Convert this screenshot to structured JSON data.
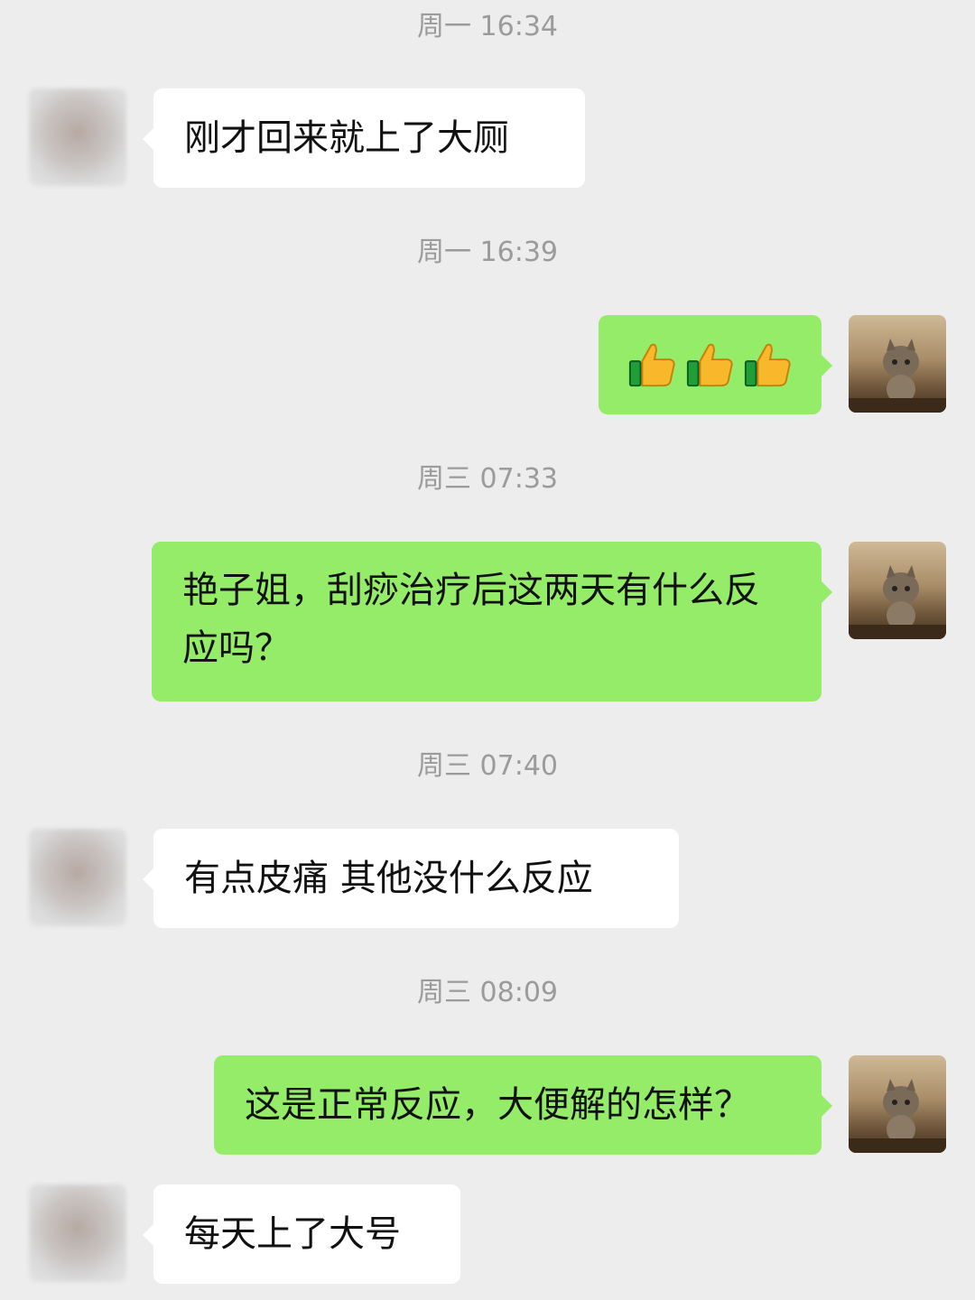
{
  "messages": [
    {
      "type": "time",
      "text": "周一 16:34"
    },
    {
      "type": "text",
      "side": "in",
      "text": "刚才回来就上了大厕"
    },
    {
      "type": "time",
      "text": "周一 16:39"
    },
    {
      "type": "emoji",
      "side": "out",
      "icons": [
        "thumbs-up-icon",
        "thumbs-up-icon",
        "thumbs-up-icon"
      ]
    },
    {
      "type": "time",
      "text": "周三 07:33"
    },
    {
      "type": "text",
      "side": "out",
      "text": "艳子姐，刮痧治疗后这两天有什么反应吗？"
    },
    {
      "type": "time",
      "text": "周三 07:40"
    },
    {
      "type": "text",
      "side": "in",
      "text": "有点皮痛 其他没什么反应"
    },
    {
      "type": "time",
      "text": "周三 08:09"
    },
    {
      "type": "text",
      "side": "out",
      "text": "这是正常反应，大便解的怎样？"
    },
    {
      "type": "text",
      "side": "in",
      "text": "每天上了大号"
    }
  ],
  "colors": {
    "background": "#ededed",
    "incoming_bubble": "#ffffff",
    "outgoing_bubble": "#95ec69",
    "timestamp": "#9b9b9b"
  }
}
